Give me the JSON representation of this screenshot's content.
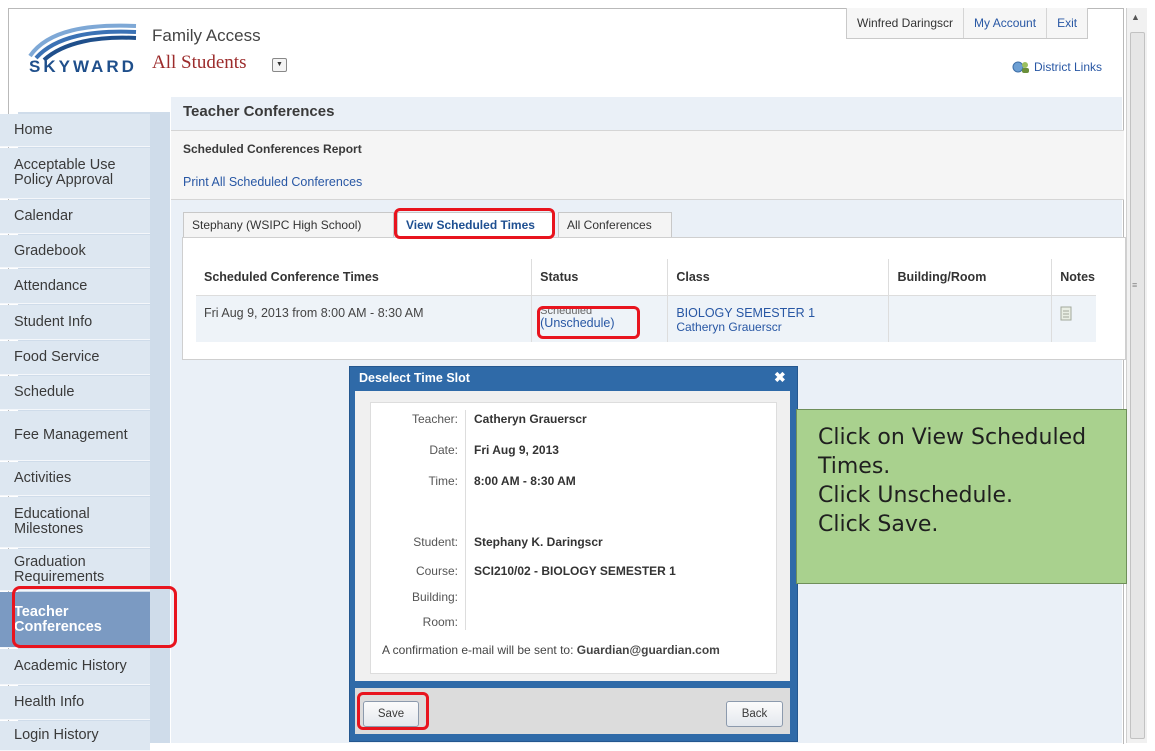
{
  "header": {
    "logo_text": "SKYWARD",
    "app_title": "Family Access",
    "student_select": "All Students",
    "nav": {
      "user": "Winfred Daringscr",
      "my_account": "My Account",
      "exit": "Exit"
    },
    "district_links": "District Links"
  },
  "sidebar": {
    "items": [
      {
        "label": "Home"
      },
      {
        "label": "Acceptable Use Policy Approval"
      },
      {
        "label": "Calendar"
      },
      {
        "label": "Gradebook"
      },
      {
        "label": "Attendance"
      },
      {
        "label": "Student Info"
      },
      {
        "label": "Food Service"
      },
      {
        "label": "Schedule"
      },
      {
        "label": "Fee Management"
      },
      {
        "label": "Activities"
      },
      {
        "label": "Educational Milestones"
      },
      {
        "label": "Graduation Requirements"
      },
      {
        "label": "Teacher Conferences"
      },
      {
        "label": "Academic History"
      },
      {
        "label": "Health Info"
      },
      {
        "label": "Login History"
      }
    ]
  },
  "main": {
    "page_title": "Teacher Conferences",
    "report_title": "Scheduled Conferences Report",
    "print_link": "Print All Scheduled Conferences",
    "tabs": [
      {
        "label": "Stephany (WSIPC High School)"
      },
      {
        "label": "View Scheduled Times"
      },
      {
        "label": "All Conferences"
      }
    ],
    "table": {
      "headers": [
        "Scheduled Conference Times",
        "Status",
        "Class",
        "Building/Room",
        "Notes"
      ],
      "row": {
        "time": "Fri Aug 9, 2013 from 8:00 AM - 8:30 AM",
        "status": "Scheduled",
        "unschedule": "(Unschedule)",
        "class_name": "BIOLOGY SEMESTER 1",
        "teacher": "Catheryn Grauerscr",
        "building_room": ""
      }
    }
  },
  "dialog": {
    "title": "Deselect Time Slot",
    "teacher_label": "Teacher:",
    "teacher": "Catheryn Grauerscr",
    "date_label": "Date:",
    "date": "Fri Aug 9, 2013",
    "time_label": "Time:",
    "time": "8:00 AM - 8:30 AM",
    "student_label": "Student:",
    "student": "Stephany K. Daringscr",
    "course_label": "Course:",
    "course": "SCI210/02 - BIOLOGY SEMESTER 1",
    "building_label": "Building:",
    "room_label": "Room:",
    "confirm_prefix": "A confirmation e-mail will be sent to:",
    "confirm_email": "Guardian@guardian.com",
    "save_label": "Save",
    "back_label": "Back"
  },
  "note": {
    "line1": "Click on View Scheduled",
    "line2": "Times.",
    "line3": "Click Unschedule.",
    "line4": "Click Save."
  },
  "colors": {
    "accent": "#2f6aa8",
    "annotation": "#e8141e",
    "note_bg": "#a9d18e"
  }
}
